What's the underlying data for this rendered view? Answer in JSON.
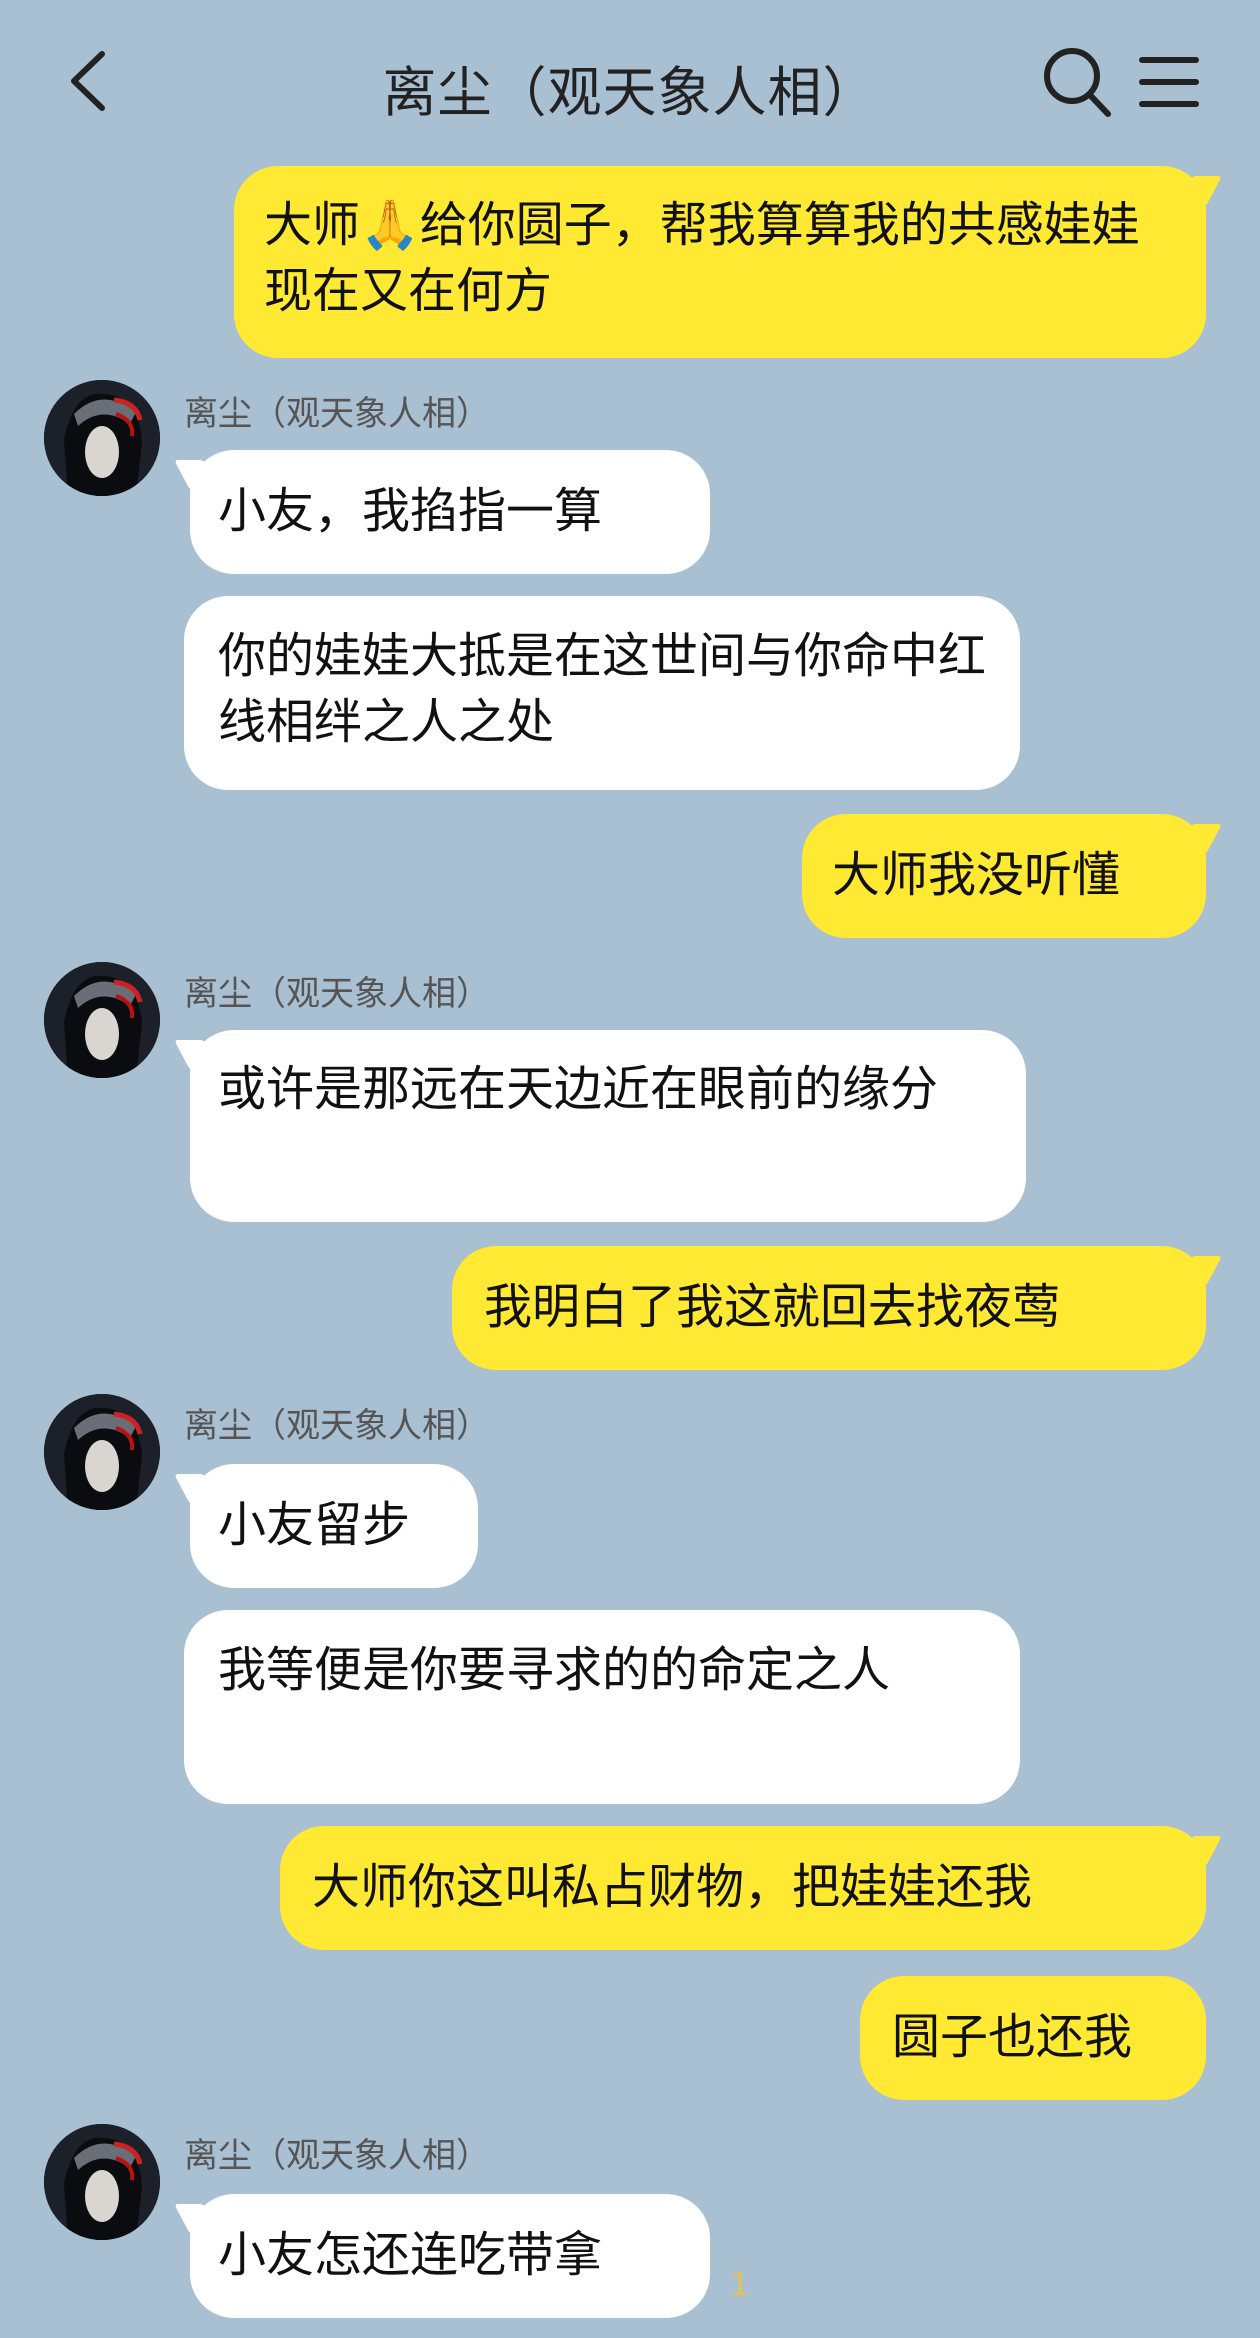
{
  "header": {
    "title": "离尘（观天象人相）"
  },
  "contact": {
    "name": "离尘（观天象人相）"
  },
  "colors": {
    "background": "#a9bfd2",
    "incoming_bubble": "#ffffff",
    "outgoing_bubble": "#ffe932"
  },
  "messages": [
    {
      "side": "out",
      "text_before": "大师",
      "emoji": "🙏",
      "text_after": "给你圆子，帮我算算我的共感娃娃现在又在何方"
    },
    {
      "side": "in",
      "text": "小友，我掐指一算"
    },
    {
      "side": "in",
      "text": "你的娃娃大抵是在这世间与你命中红线相绊之人之处"
    },
    {
      "side": "out",
      "text": "大师我没听懂"
    },
    {
      "side": "in",
      "text": "或许是那远在天边近在眼前的缘分"
    },
    {
      "side": "out",
      "text": "我明白了我这就回去找夜莺"
    },
    {
      "side": "in",
      "text": "小友留步"
    },
    {
      "side": "in",
      "text": "我等便是你要寻求的的命定之人"
    },
    {
      "side": "out",
      "text": "大师你这叫私占财物，把娃娃还我"
    },
    {
      "side": "out",
      "text": "圆子也还我"
    },
    {
      "side": "in",
      "text": "小友怎还连吃带拿"
    }
  ],
  "unread_count": "1"
}
